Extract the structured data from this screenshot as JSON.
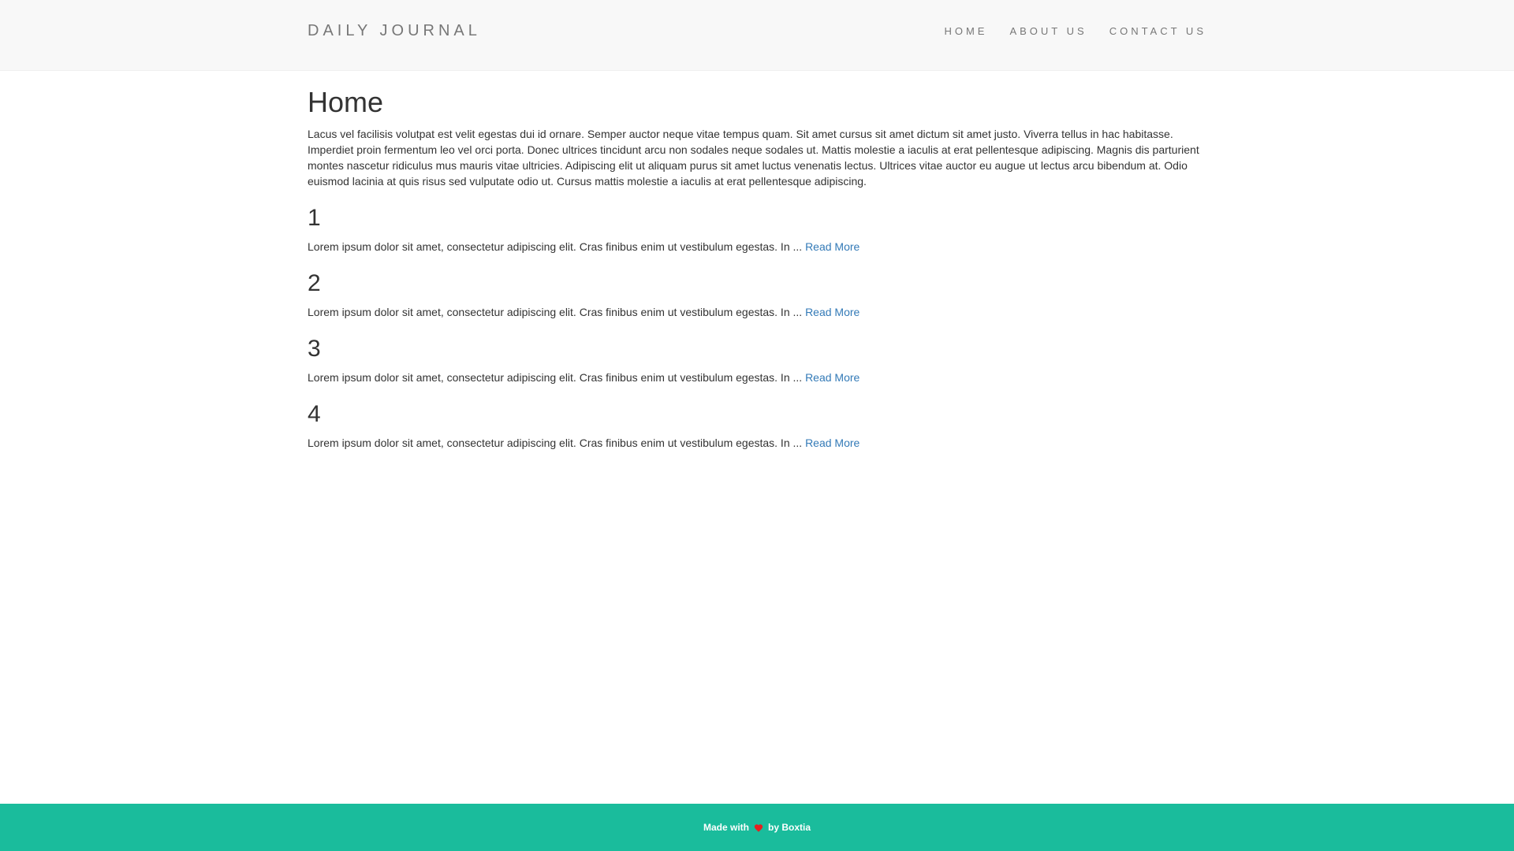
{
  "navbar": {
    "brand": "DAILY JOURNAL",
    "links": [
      "HOME",
      "ABOUT US",
      "CONTACT US"
    ]
  },
  "main": {
    "title": "Home",
    "intro": "Lacus vel facilisis volutpat est velit egestas dui id ornare. Semper auctor neque vitae tempus quam. Sit amet cursus sit amet dictum sit amet justo. Viverra tellus in hac habitasse. Imperdiet proin fermentum leo vel orci porta. Donec ultrices tincidunt arcu non sodales neque sodales ut. Mattis molestie a iaculis at erat pellentesque adipiscing. Magnis dis parturient montes nascetur ridiculus mus mauris vitae ultricies. Adipiscing elit ut aliquam purus sit amet luctus venenatis lectus. Ultrices vitae auctor eu augue ut lectus arcu bibendum at. Odio euismod lacinia at quis risus sed vulputate odio ut. Cursus mattis molestie a iaculis at erat pellentesque adipiscing.",
    "posts": [
      {
        "title": "1",
        "excerpt": "Lorem ipsum dolor sit amet, consectetur adipiscing elit. Cras finibus enim ut vestibulum egestas. In ... ",
        "read_more": "Read More"
      },
      {
        "title": "2",
        "excerpt": "Lorem ipsum dolor sit amet, consectetur adipiscing elit. Cras finibus enim ut vestibulum egestas. In ... ",
        "read_more": "Read More"
      },
      {
        "title": "3",
        "excerpt": "Lorem ipsum dolor sit amet, consectetur adipiscing elit. Cras finibus enim ut vestibulum egestas. In ... ",
        "read_more": "Read More"
      },
      {
        "title": "4",
        "excerpt": "Lorem ipsum dolor sit amet, consectetur adipiscing elit. Cras finibus enim ut vestibulum egestas. In ... ",
        "read_more": "Read More"
      }
    ]
  },
  "footer": {
    "made_with": "Made with",
    "heart_icon": "heart-icon",
    "by": "by Boxtia"
  },
  "colors": {
    "navbar_bg": "#f8f8f8",
    "footer_bg": "#1abc9c",
    "link": "#337ab7",
    "heart": "#e52020"
  }
}
